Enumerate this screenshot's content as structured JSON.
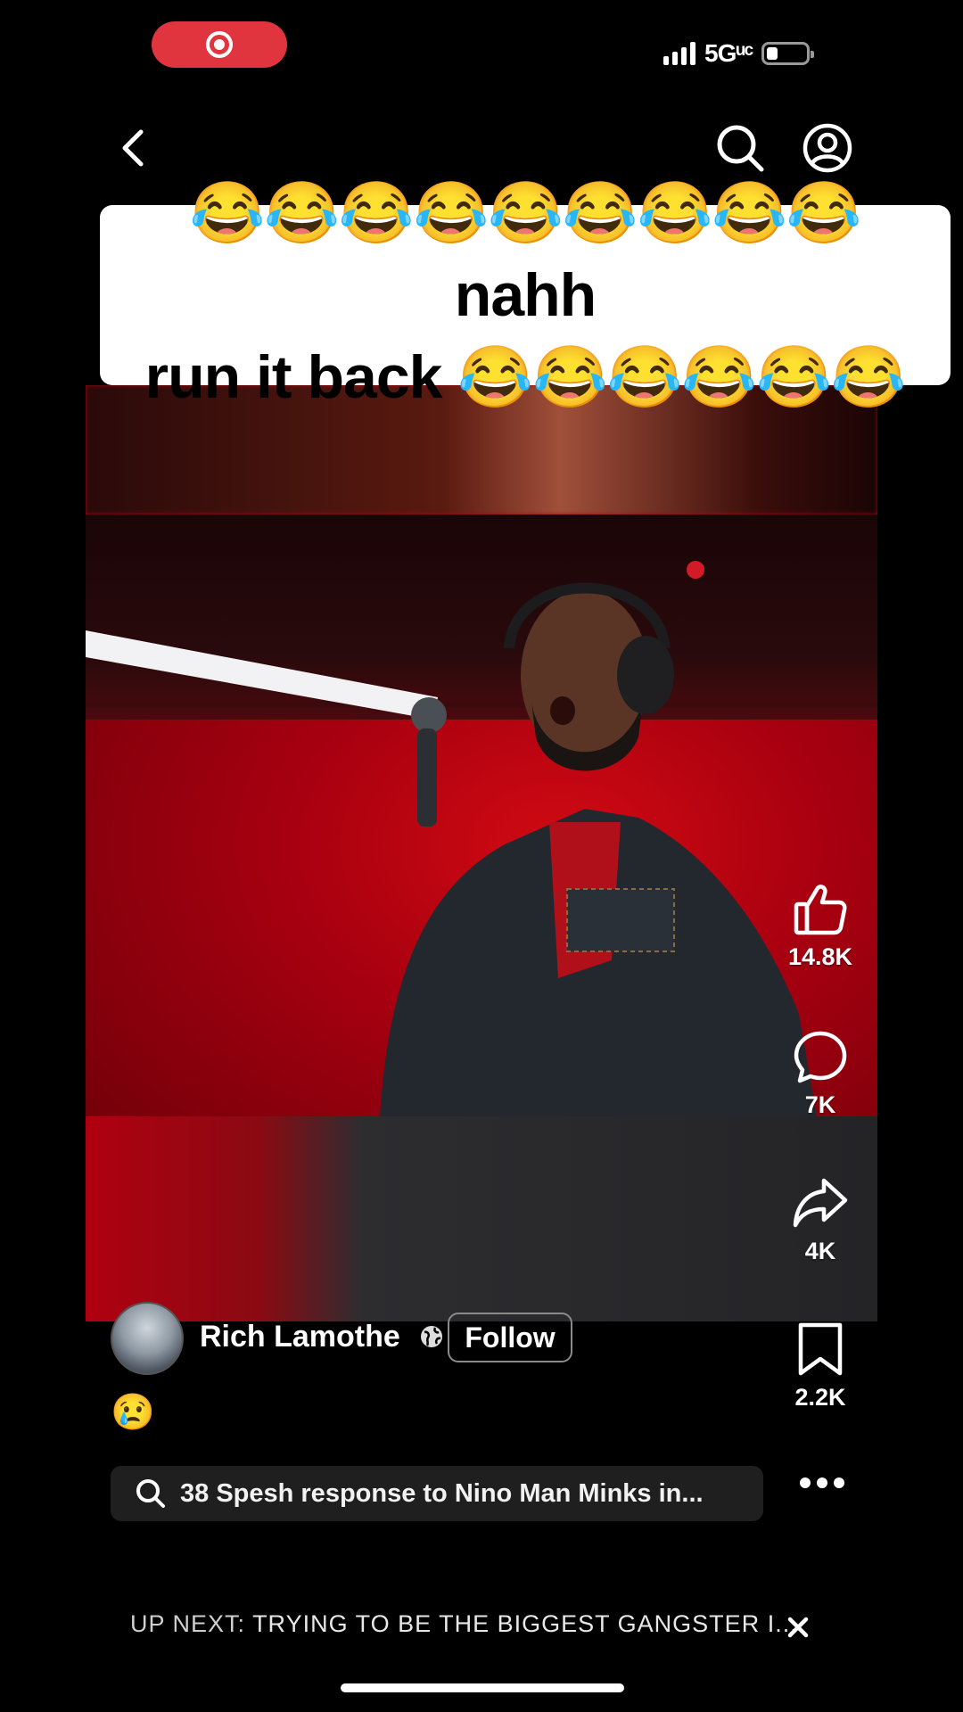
{
  "status_bar": {
    "network": "5Gᵘᶜ"
  },
  "caption": {
    "line1": "😂😂😂😂😂😂😂😂😂 nahh",
    "line2": "run it back 😂😂😂😂😂😂"
  },
  "actions": {
    "likes": "14.8K",
    "comments": "7K",
    "shares": "4K",
    "saves": "2.2K"
  },
  "author": {
    "name": "Rich Lamothe",
    "follow_label": "Follow",
    "description": "😢"
  },
  "search": {
    "text": "38 Spesh response to Nino Man Minks in..."
  },
  "up_next": {
    "label": "UP NEXT:",
    "title": "TRYING TO BE THE BIGGEST GANGSTER I..."
  },
  "colors": {
    "record": "#e0343e",
    "video_red": "#b00010"
  }
}
